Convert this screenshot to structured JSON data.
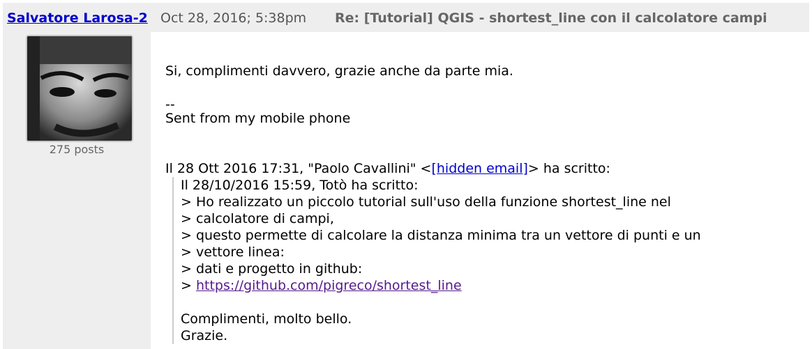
{
  "post": {
    "author": "Salvatore Larosa-2",
    "date": "Oct 28, 2016; 5:38pm",
    "subject": "Re: [Tutorial] QGIS - shortest_line con il calcolatore campi",
    "posts_count": "275 posts"
  },
  "message": {
    "intro": "Si, complimenti davvero, grazie anche da parte mia.",
    "sig_dash": "--",
    "sig_text": "Sent from my mobile phone",
    "reply_prefix": "Il 28 Ott 2016 17:31, \"Paolo Cavallini\" <",
    "hidden_email": "[hidden email]",
    "reply_suffix": "> ha scritto:",
    "quote": {
      "l1": "Il 28/10/2016 15:59, Totò ha scritto:",
      "l2": "> Ho realizzato un piccolo tutorial sull'uso della funzione shortest_line nel",
      "l3": "> calcolatore di campi,",
      "l4": "> questo permette di calcolare la distanza minima tra un vettore di punti e un",
      "l5": "> vettore linea:",
      "l6": "> dati e progetto in github:",
      "l7_prefix": "> ",
      "l7_link": "https://github.com/pigreco/shortest_line",
      "l8": "Complimenti, molto bello.",
      "l9": "Grazie."
    }
  }
}
